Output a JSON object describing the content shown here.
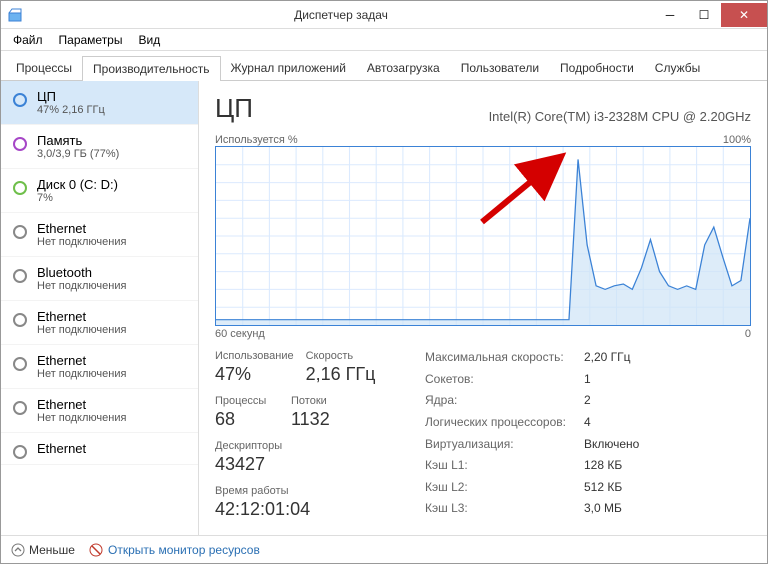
{
  "window": {
    "title": "Диспетчер задач"
  },
  "menu": {
    "file": "Файл",
    "options": "Параметры",
    "view": "Вид"
  },
  "tabs": {
    "processes": "Процессы",
    "performance": "Производительность",
    "apphistory": "Журнал приложений",
    "startup": "Автозагрузка",
    "users": "Пользователи",
    "details": "Подробности",
    "services": "Службы"
  },
  "sidebar": {
    "items": [
      {
        "name": "ЦП",
        "sub": "47% 2,16 ГГц"
      },
      {
        "name": "Память",
        "sub": "3,0/3,9 ГБ (77%)"
      },
      {
        "name": "Диск 0 (C: D:)",
        "sub": "7%"
      },
      {
        "name": "Ethernet",
        "sub": "Нет подключения"
      },
      {
        "name": "Bluetooth",
        "sub": "Нет подключения"
      },
      {
        "name": "Ethernet",
        "sub": "Нет подключения"
      },
      {
        "name": "Ethernet",
        "sub": "Нет подключения"
      },
      {
        "name": "Ethernet",
        "sub": "Нет подключения"
      },
      {
        "name": "Ethernet",
        "sub": ""
      }
    ]
  },
  "detail": {
    "name": "ЦП",
    "desc": "Intel(R) Core(TM) i3-2328M CPU @ 2.20GHz",
    "chart_top_left": "Используется %",
    "chart_top_right": "100%",
    "chart_bottom_left": "60 секунд",
    "chart_bottom_right": "0"
  },
  "stats": {
    "util_label": "Использование",
    "util_value": "47%",
    "speed_label": "Скорость",
    "speed_value": "2,16 ГГц",
    "proc_label": "Процессы",
    "proc_value": "68",
    "thread_label": "Потоки",
    "thread_value": "1132",
    "handle_label": "Дескрипторы",
    "handle_value": "43427",
    "uptime_label": "Время работы",
    "uptime_value": "42:12:01:04"
  },
  "info": {
    "maxspeed_l": "Максимальная скорость:",
    "maxspeed_v": "2,20 ГГц",
    "sockets_l": "Сокетов:",
    "sockets_v": "1",
    "cores_l": "Ядра:",
    "cores_v": "2",
    "logical_l": "Логических процессоров:",
    "logical_v": "4",
    "virt_l": "Виртуализация:",
    "virt_v": "Включено",
    "l1_l": "Кэш L1:",
    "l1_v": "128 КБ",
    "l2_l": "Кэш L2:",
    "l2_v": "512 КБ",
    "l3_l": "Кэш L3:",
    "l3_v": "3,0 МБ"
  },
  "footer": {
    "less": "Меньше",
    "resmon": "Открыть монитор ресурсов"
  },
  "chart_data": {
    "type": "line",
    "title": "ЦП — Используется %",
    "xlabel": "60 секунд",
    "ylabel": "Используется %",
    "ylim": [
      0,
      100
    ],
    "x_range_seconds": [
      60,
      0
    ],
    "values": [
      3,
      3,
      3,
      3,
      3,
      3,
      3,
      3,
      3,
      3,
      3,
      3,
      3,
      3,
      3,
      3,
      3,
      3,
      3,
      3,
      3,
      3,
      3,
      3,
      3,
      3,
      3,
      3,
      3,
      3,
      3,
      3,
      3,
      3,
      3,
      3,
      3,
      3,
      3,
      3,
      93,
      45,
      22,
      20,
      22,
      23,
      20,
      32,
      48,
      30,
      22,
      20,
      22,
      20,
      45,
      55,
      38,
      22,
      25,
      60
    ]
  }
}
